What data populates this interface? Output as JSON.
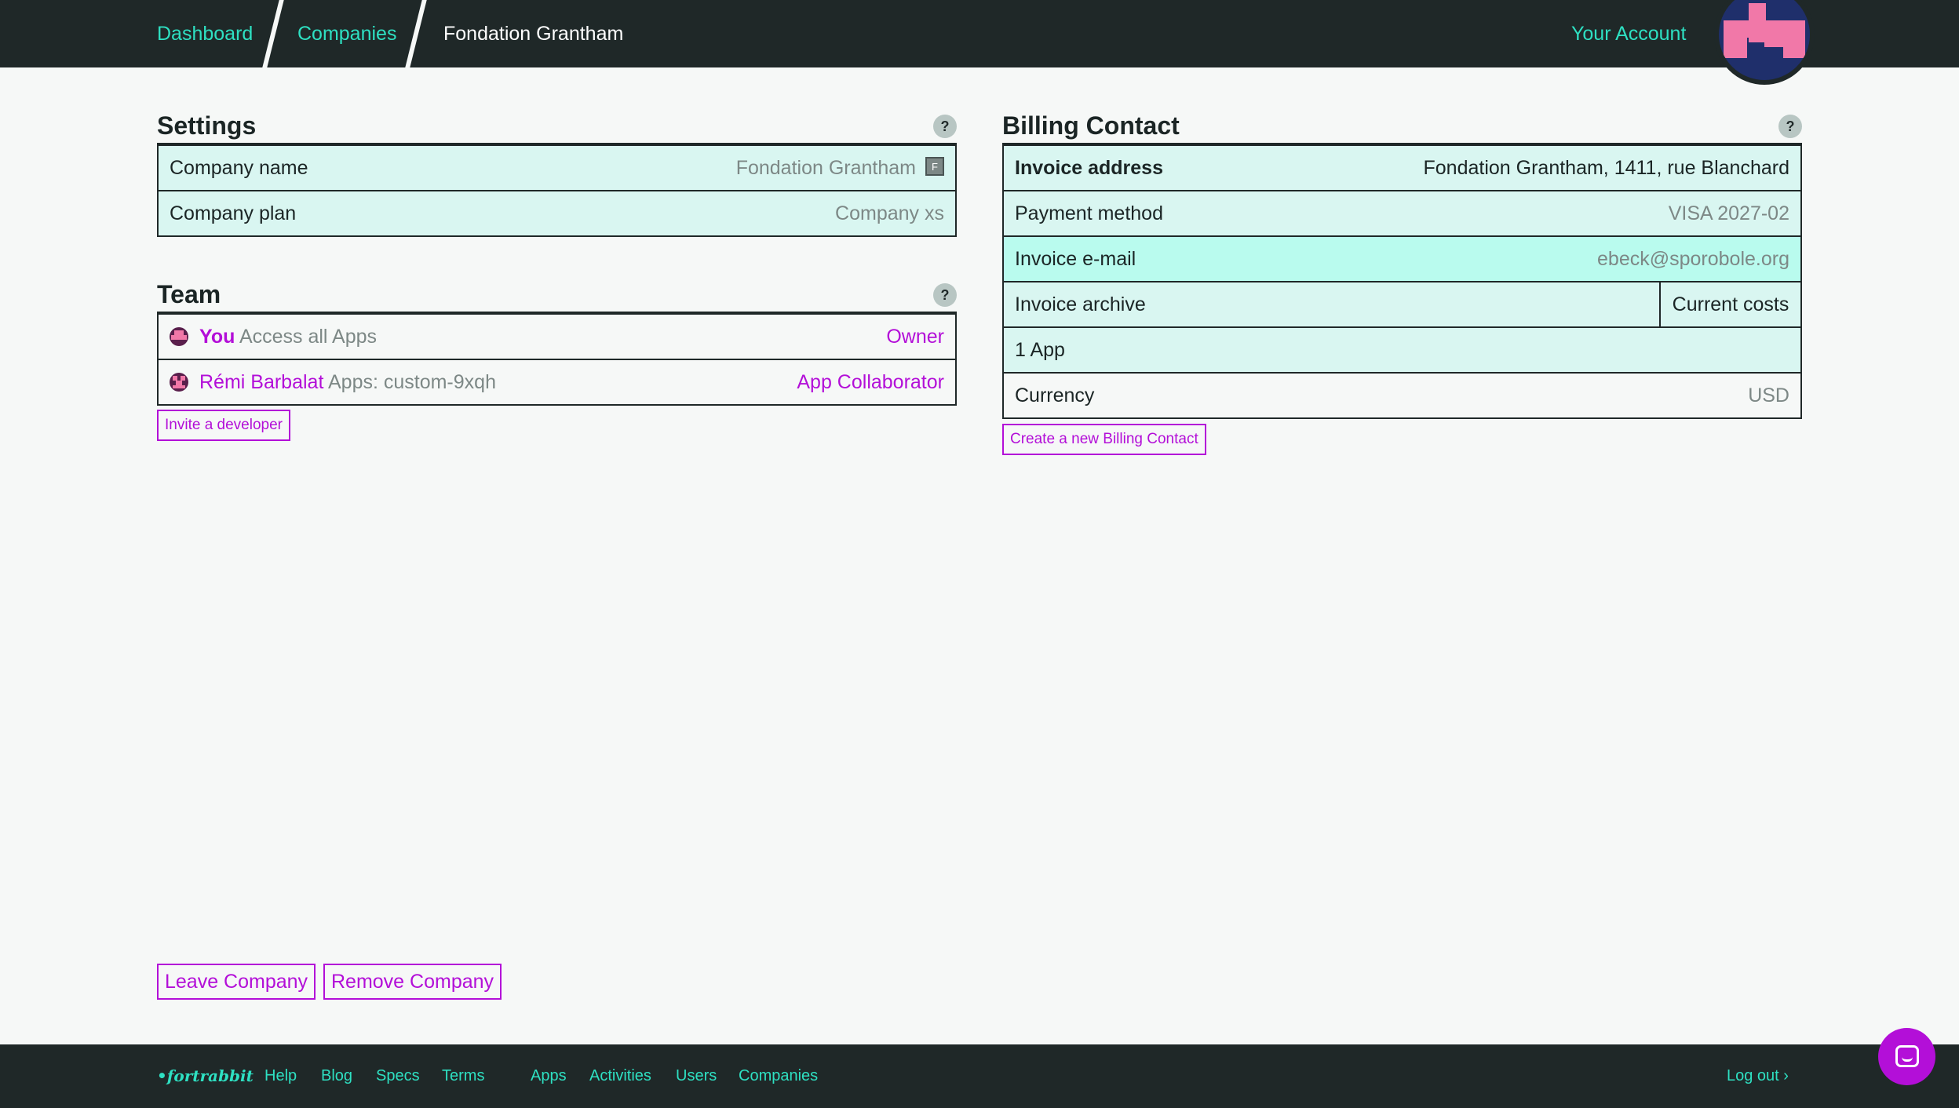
{
  "nav": {
    "dashboard": "Dashboard",
    "companies": "Companies",
    "current": "Fondation Grantham",
    "account": "Your Account"
  },
  "settings": {
    "title": "Settings",
    "help": "?",
    "rows": [
      {
        "label": "Company name",
        "value": "Fondation Grantham",
        "badge": "F"
      },
      {
        "label": "Company plan",
        "value": "Company xs"
      }
    ]
  },
  "team": {
    "title": "Team",
    "help": "?",
    "members": [
      {
        "name": "You",
        "sub": "Access all Apps",
        "role": "Owner"
      },
      {
        "name": "Rémi Barbalat",
        "sub": "Apps: custom-9xqh",
        "role": "App Collaborator"
      }
    ],
    "invite_label": "Invite a developer"
  },
  "billing": {
    "title": "Billing Contact",
    "help": "?",
    "invoice_address_label": "Invoice address",
    "invoice_address_value": "Fondation Grantham, 1411, rue Blanchard",
    "payment_label": "Payment method",
    "payment_value": "VISA 2027-02",
    "email_label": "Invoice e-mail",
    "email_value": "ebeck@sporobole.org",
    "archive_label": "Invoice archive",
    "current_costs_label": "Current costs",
    "apps_label": "1 App",
    "currency_label": "Currency",
    "currency_value": "USD",
    "create_label": "Create a new Billing Contact"
  },
  "actions": {
    "leave": "Leave Company",
    "remove": "Remove Company"
  },
  "footer": {
    "logo": "•fortrabbit",
    "links": [
      "Help",
      "Blog",
      "Specs",
      "Terms"
    ],
    "app_links": [
      "Apps",
      "Activities",
      "Users",
      "Companies"
    ],
    "logout": "Log out ›"
  },
  "colors": {
    "accent_teal": "#2ee0c2",
    "accent_purple": "#b30fd8",
    "dark_bar": "#1f2828",
    "row_fill": "#d9f6f1"
  }
}
